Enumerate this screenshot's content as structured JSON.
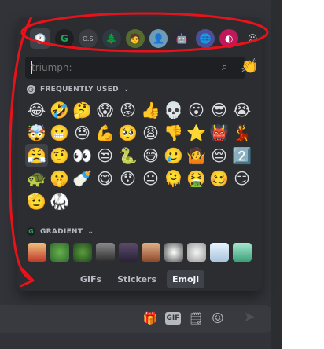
{
  "search": {
    "value": "",
    "placeholder": "triumph:"
  },
  "sections": [
    {
      "title": "FREQUENTLY USED",
      "icon": "clock-icon"
    },
    {
      "title": "GRADIENT",
      "icon": "server-icon"
    }
  ],
  "frequent_emojis": [
    "😂",
    "🤣",
    "🤔",
    "😱",
    "😡",
    "👍",
    "💀",
    "😮",
    "😎",
    "😭",
    "🤯",
    "😬",
    "😓",
    "💪",
    "🥺",
    "😩",
    "👎",
    "⭐",
    "👹",
    "💃",
    "😤",
    "🤨",
    "👀",
    "😒",
    "🐍",
    "😅",
    "🥲",
    "🤷",
    "😔",
    "2️⃣",
    "🐢",
    "🤫",
    "🍼",
    "😋",
    "😯",
    "😐",
    "🫠",
    "🤮",
    "🥴",
    "😏",
    "🫡",
    "🥋"
  ],
  "gradient_emojis": [
    "trump",
    "pepe1",
    "pepe2",
    "knight",
    "figure",
    "fire-dog",
    "panda",
    "troll",
    "ghost",
    "cat"
  ],
  "tabs": [
    {
      "label": "GIFs",
      "active": false
    },
    {
      "label": "Stickers",
      "active": false
    },
    {
      "label": "Emoji",
      "active": true
    }
  ],
  "colors": {
    "annotation": "#e8121b",
    "accent": "#23a55a"
  }
}
